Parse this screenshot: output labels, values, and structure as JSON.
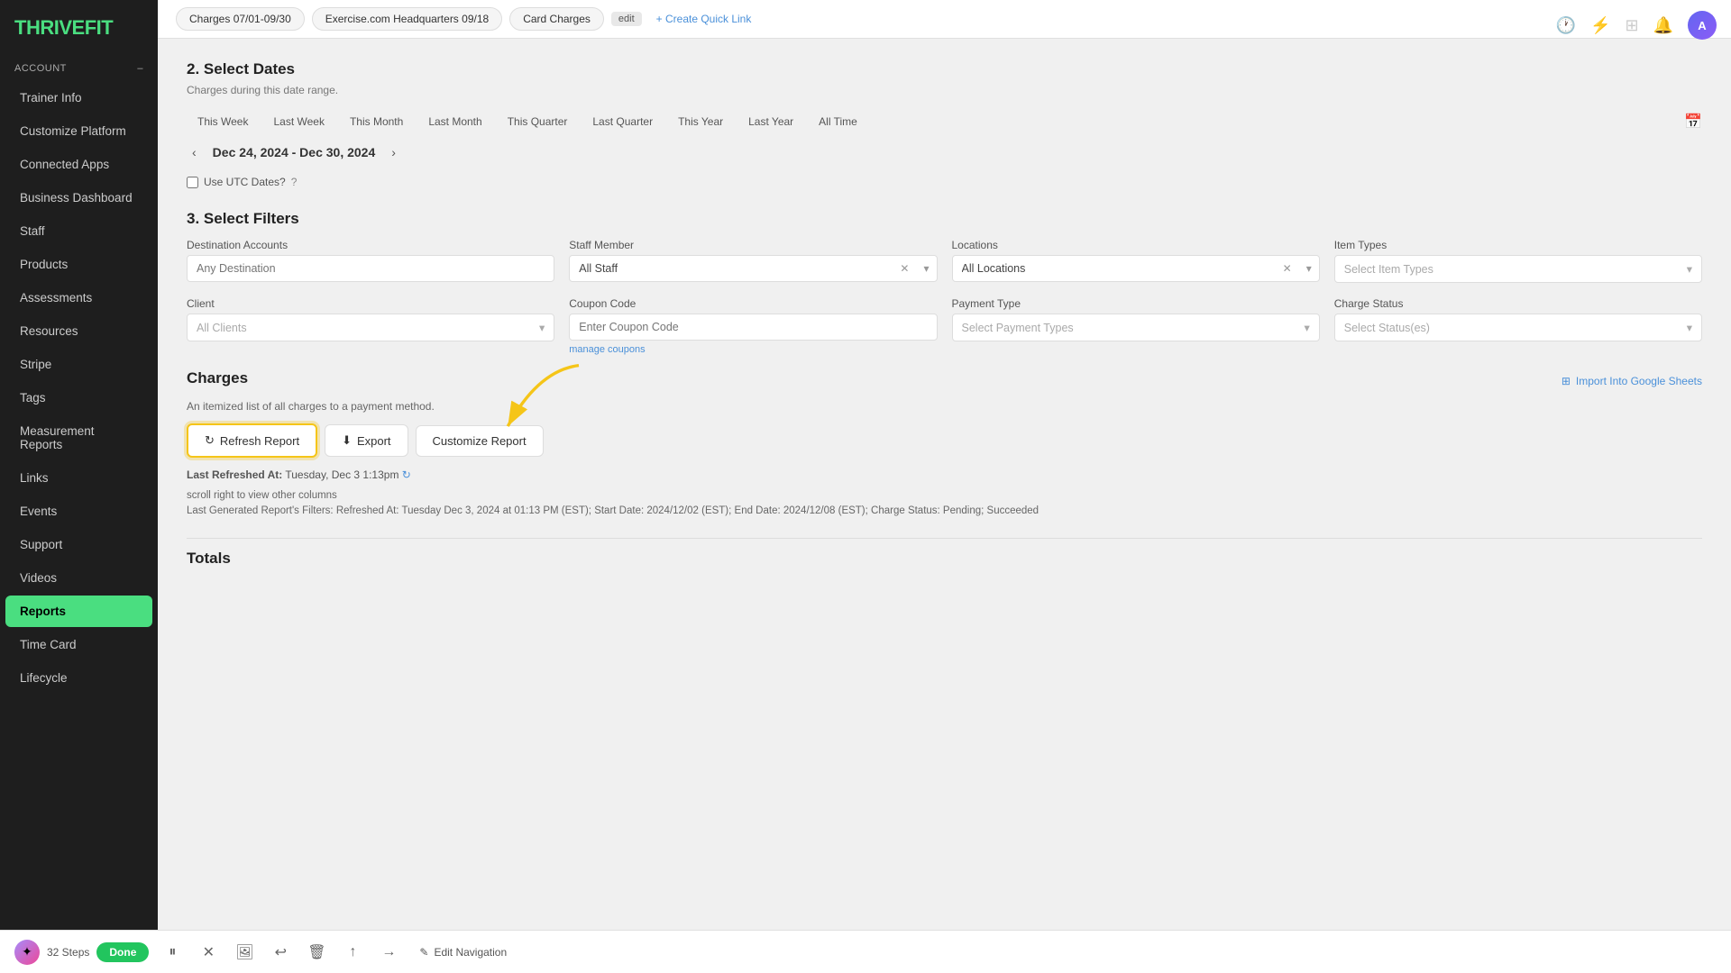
{
  "brand": {
    "name_part1": "THRIVE",
    "name_part2": "FIT"
  },
  "top_nav": {
    "quick_links": [
      {
        "label": "Charges 07/01-09/30"
      },
      {
        "label": "Exercise.com Headquarters 09/18"
      },
      {
        "label": "Card Charges"
      }
    ],
    "edit_label": "edit",
    "create_quick_link": "+ Create Quick Link"
  },
  "sidebar": {
    "section_label": "Account",
    "items": [
      {
        "label": "Trainer Info",
        "id": "trainer-info",
        "active": false
      },
      {
        "label": "Customize Platform",
        "id": "customize-platform",
        "active": false
      },
      {
        "label": "Connected Apps",
        "id": "connected-apps",
        "active": false
      },
      {
        "label": "Business Dashboard",
        "id": "business-dashboard",
        "active": false
      },
      {
        "label": "Staff",
        "id": "staff",
        "active": false
      },
      {
        "label": "Products",
        "id": "products",
        "active": false
      },
      {
        "label": "Assessments",
        "id": "assessments",
        "active": false
      },
      {
        "label": "Resources",
        "id": "resources",
        "active": false
      },
      {
        "label": "Stripe",
        "id": "stripe",
        "active": false
      },
      {
        "label": "Tags",
        "id": "tags",
        "active": false
      },
      {
        "label": "Measurement Reports",
        "id": "measurement-reports",
        "active": false
      },
      {
        "label": "Links",
        "id": "links",
        "active": false
      },
      {
        "label": "Events",
        "id": "events",
        "active": false
      },
      {
        "label": "Support",
        "id": "support",
        "active": false
      },
      {
        "label": "Videos",
        "id": "videos",
        "active": false
      },
      {
        "label": "Reports",
        "id": "reports",
        "active": true
      },
      {
        "label": "Time Card",
        "id": "time-card",
        "active": false
      },
      {
        "label": "Lifecycle",
        "id": "lifecycle",
        "active": false
      }
    ]
  },
  "dates": {
    "section_title": "2. Select Dates",
    "section_subtitle": "Charges during this date range.",
    "tabs": [
      {
        "label": "This Week",
        "active": false
      },
      {
        "label": "Last Week",
        "active": false
      },
      {
        "label": "This Month",
        "active": false
      },
      {
        "label": "Last Month",
        "active": false
      },
      {
        "label": "This Quarter",
        "active": false
      },
      {
        "label": "Last Quarter",
        "active": false
      },
      {
        "label": "This Year",
        "active": false
      },
      {
        "label": "Last Year",
        "active": false
      },
      {
        "label": "All Time",
        "active": false
      }
    ],
    "current_range": "Dec 24, 2024 - Dec 30, 2024",
    "utc_label": "Use UTC Dates?"
  },
  "filters": {
    "section_title": "3. Select Filters",
    "destination_accounts_label": "Destination Accounts",
    "destination_placeholder": "Any Destination",
    "staff_member_label": "Staff Member",
    "staff_member_value": "All Staff",
    "locations_label": "Locations",
    "locations_value": "All Locations",
    "item_types_label": "Item Types",
    "item_types_placeholder": "Select Item Types",
    "client_label": "Client",
    "client_placeholder": "All Clients",
    "coupon_code_label": "Coupon Code",
    "coupon_code_placeholder": "Enter Coupon Code",
    "manage_coupons": "manage coupons",
    "payment_type_label": "Payment Type",
    "payment_type_placeholder": "Select Payment Types",
    "charge_status_label": "Charge Status",
    "charge_status_placeholder": "Select Status(es)"
  },
  "charges": {
    "section_title": "Charges",
    "import_label": "Import Into Google Sheets",
    "description": "An itemized list of all charges to a payment method.",
    "refresh_label": "Refresh Report",
    "export_label": "Export",
    "customize_label": "Customize Report",
    "last_refreshed_label": "Last Refreshed At:",
    "last_refreshed_value": "Tuesday, Dec 3 1:13pm",
    "report_info": "scroll right to view other columns",
    "report_filters": "Last Generated Report's Filters: Refreshed At: Tuesday Dec 3, 2024 at 01:13 PM (EST); Start Date: 2024/12/02 (EST); End Date: 2024/12/08 (EST); Charge Status: Pending; Succeeded"
  },
  "totals": {
    "label": "Totals"
  },
  "bottom_bar": {
    "steps_count": "32 Steps",
    "done_label": "Done"
  },
  "top_icons": {
    "avatar_initials": "A"
  }
}
